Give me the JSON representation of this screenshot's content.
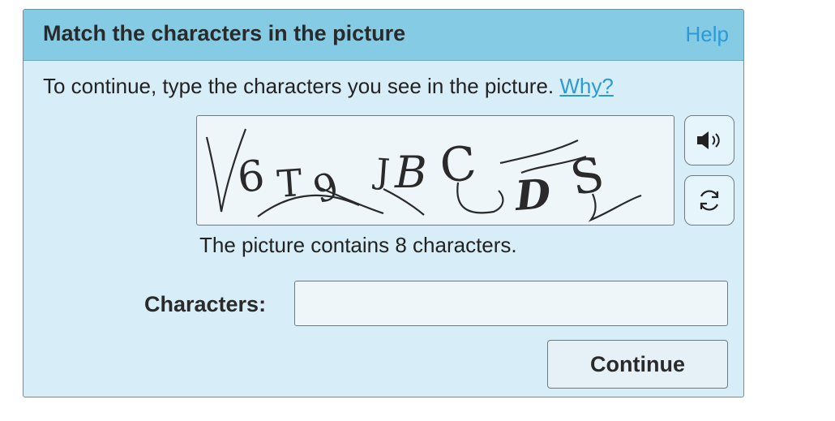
{
  "dialog": {
    "title": "Match the characters in the picture",
    "help_label": "Help",
    "instruction": "To continue, type the characters you see in the picture.",
    "why_label": "Why?",
    "captcha": {
      "characters_shown": [
        "V",
        "6",
        "T",
        "9",
        "J",
        "B",
        "C",
        "D",
        "S"
      ],
      "audio_icon": "speaker-icon",
      "refresh_icon": "refresh-icon"
    },
    "count_text": "The picture contains 8 characters.",
    "field_label": "Characters:",
    "input_value": "",
    "input_placeholder": "",
    "continue_label": "Continue"
  },
  "colors": {
    "header_bg": "#86cbe4",
    "body_bg": "#d7eef8",
    "link": "#2b9ad6",
    "border": "#6f7a82"
  }
}
